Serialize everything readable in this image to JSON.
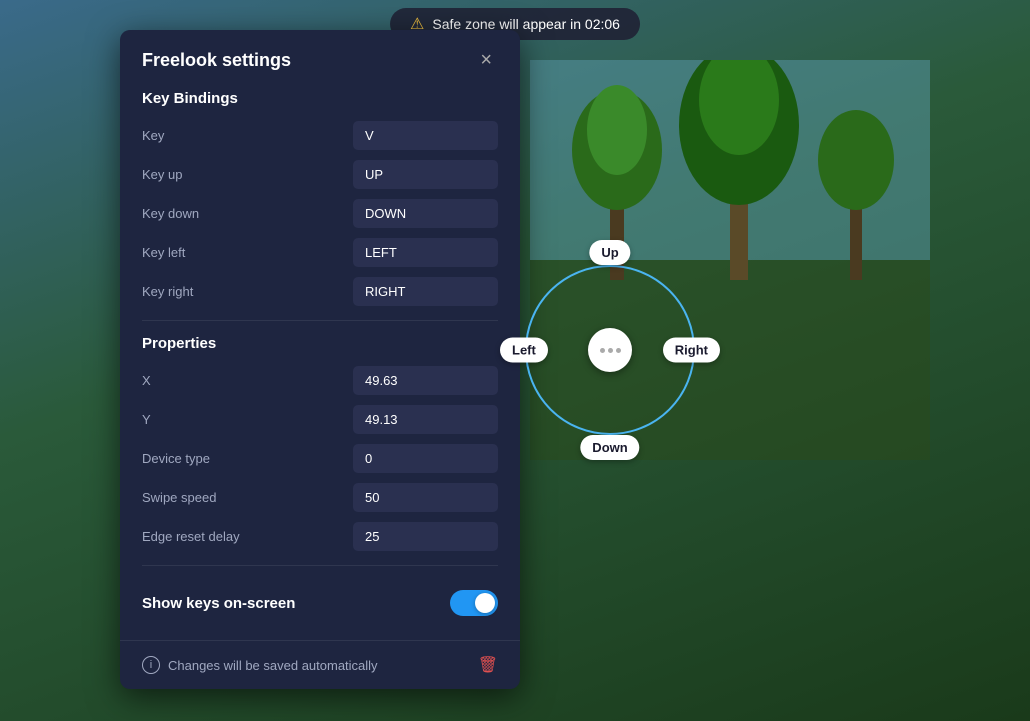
{
  "background": {
    "safe_zone_text": "Safe zone will appear in 02:06"
  },
  "dialog": {
    "title": "Freelook settings",
    "close_label": "×",
    "sections": {
      "key_bindings": {
        "title": "Key Bindings",
        "fields": [
          {
            "label": "Key",
            "value": "V"
          },
          {
            "label": "Key up",
            "value": "UP"
          },
          {
            "label": "Key down",
            "value": "DOWN"
          },
          {
            "label": "Key left",
            "value": "LEFT"
          },
          {
            "label": "Key right",
            "value": "RIGHT"
          }
        ]
      },
      "properties": {
        "title": "Properties",
        "fields": [
          {
            "label": "X",
            "value": "49.63"
          },
          {
            "label": "Y",
            "value": "49.13"
          },
          {
            "label": "Device type",
            "value": "0"
          },
          {
            "label": "Swipe speed",
            "value": "50"
          },
          {
            "label": "Edge reset delay",
            "value": "25"
          }
        ]
      }
    },
    "toggle": {
      "label": "Show keys on-screen",
      "enabled": true
    },
    "footer": {
      "info_text": "Changes will be saved automatically"
    }
  },
  "joystick": {
    "directions": {
      "up": "Up",
      "down": "Down",
      "left": "Left",
      "right": "Right"
    }
  }
}
